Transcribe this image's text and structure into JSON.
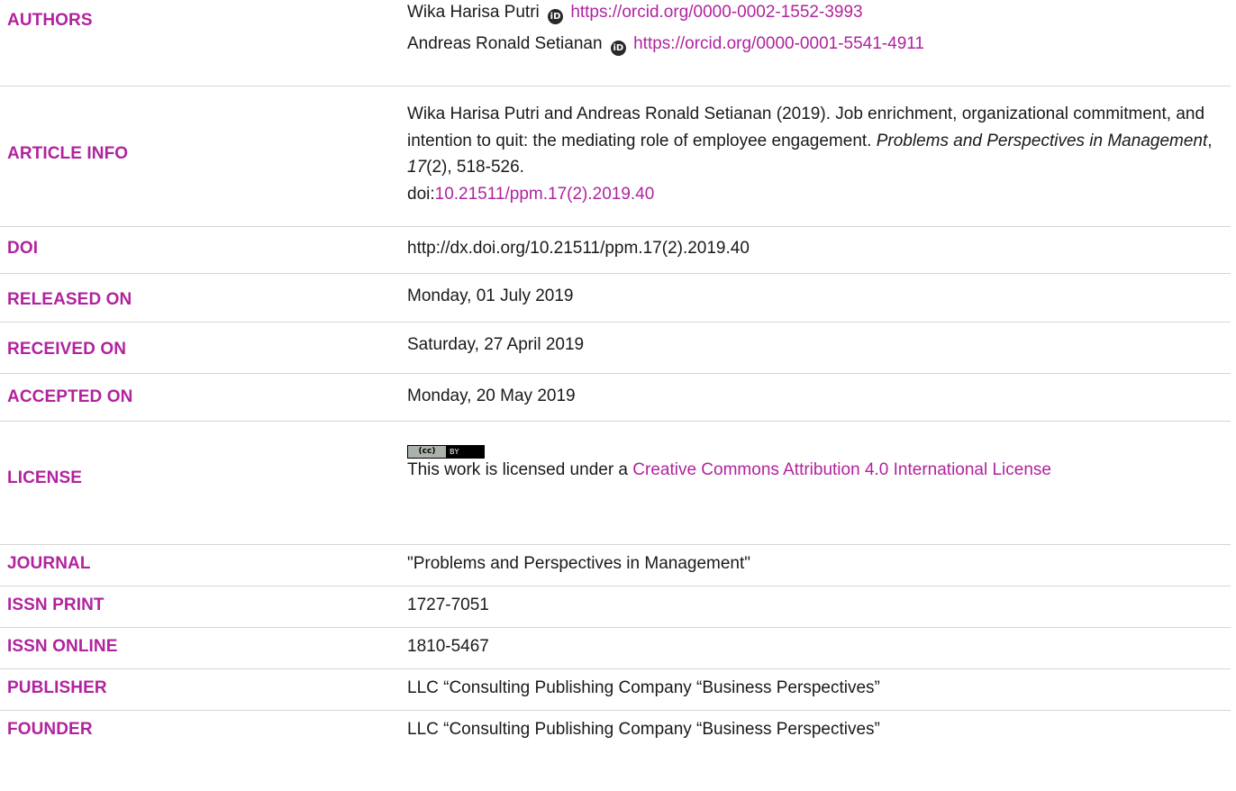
{
  "authors": {
    "label": "AUTHORS",
    "list": [
      {
        "name": "Wika Harisa Putri",
        "orcid_icon": "iD",
        "orcid_url": "https://orcid.org/0000-0002-1552-3993"
      },
      {
        "name": "Andreas Ronald Setianan",
        "orcid_icon": "iD",
        "orcid_url": "https://orcid.org/0000-0001-5541-4911"
      }
    ]
  },
  "article_info": {
    "label": "ARTICLE INFO",
    "citation_plain": "Wika Harisa Putri and Andreas Ronald Setianan (2019). Job enrichment, organizational commitment, and intention to quit: the mediating role of employee engagement. ",
    "journal_italic": "Problems and Perspectives in Management",
    "sep1": ", ",
    "volume_italic": "17",
    "issue_pages": "(2), 518-526.",
    "doi_prefix": "doi:",
    "doi_link": "10.21511/ppm.17(2).2019.40"
  },
  "doi": {
    "label": "DOI",
    "value": "http://dx.doi.org/10.21511/ppm.17(2).2019.40"
  },
  "released_on": {
    "label": "RELEASED ON",
    "value": "Monday, 01 July 2019"
  },
  "received_on": {
    "label": "RECEIVED ON",
    "value": "Saturday, 27 April 2019"
  },
  "accepted_on": {
    "label": "ACCEPTED ON",
    "value": "Monday, 20 May 2019"
  },
  "license": {
    "label": "LICENSE",
    "badge_left": "(cc)",
    "badge_right": "BY",
    "text_prefix": "This work is licensed under a ",
    "link_text": "Creative Commons Attribution 4.0 International License"
  },
  "journal": {
    "label": "JOURNAL",
    "value": "\"Problems and Perspectives in Management\""
  },
  "issn_print": {
    "label": "ISSN PRINT",
    "value": "1727-7051"
  },
  "issn_online": {
    "label": "ISSN ONLINE",
    "value": "1810-5467"
  },
  "publisher": {
    "label": "PUBLISHER",
    "value": "LLC “Consulting Publishing Company “Business Perspectives”"
  },
  "founder": {
    "label": "FOUNDER",
    "value": "LLC “Consulting Publishing Company “Business Perspectives”"
  },
  "colors": {
    "accent": "#b1239e",
    "text": "#1a1a1a",
    "divider": "#d6d6d6"
  }
}
